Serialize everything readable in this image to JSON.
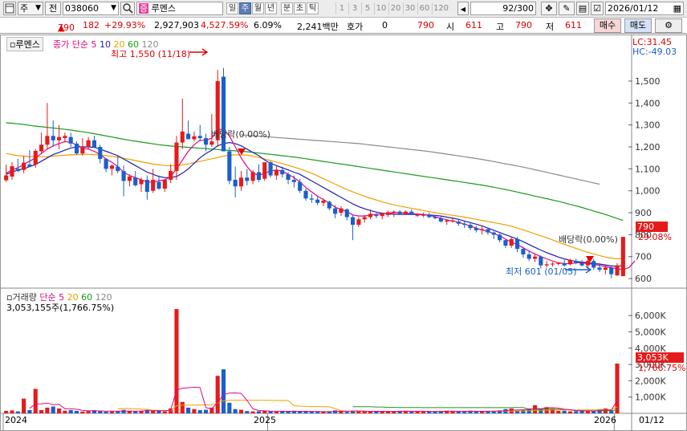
{
  "toolbar": {
    "market": "주",
    "period_prev": "전",
    "code": "038060",
    "name": "루멘스",
    "name_tag": "증",
    "intervals": [
      "일",
      "주",
      "월",
      "년",
      "분",
      "초",
      "틱"
    ],
    "numbers": [
      "1",
      "3",
      "5",
      "10",
      "20",
      "30",
      "60",
      "120"
    ],
    "count": "92",
    "count_total": "/300",
    "date": "2026/01/12"
  },
  "price": {
    "current": "790",
    "arrow": "▲",
    "change": "182",
    "pct": "+29.93%",
    "volume": "2,927,903",
    "vol_pct": "4,527.59%",
    "turnover": "6.09%",
    "amount": "2,241백만",
    "bid_label": "호가",
    "bid_value": "0",
    "ask_value": "790",
    "open_label": "시",
    "open": "611",
    "high_label": "고",
    "high": "790",
    "low_label": "저",
    "low": "611",
    "buy": "매수",
    "sell": "매도"
  },
  "panel1": {
    "name": "루멘스",
    "ma_label": "종가 단순",
    "ma": [
      "5",
      "10",
      "20",
      "60",
      "120"
    ],
    "lc": "LC:31.45",
    "hc": "HC:-49.03",
    "high_mark": "최고 1,550 (11/18)",
    "low_mark": "최저 601 (01/05)",
    "div1": "배당락(0.00%)",
    "div2": "배당락(0.00%)",
    "price_tag": "790",
    "pct_tag": "29.08%"
  },
  "panel2": {
    "name": "거래량",
    "ma_label": "단순",
    "ma": [
      "5",
      "20",
      "60",
      "120"
    ],
    "current": "3,053,155주(1,766.75%)",
    "vol_tag": "3,053K",
    "pct_tag": "1,766.75%"
  },
  "x_axis": [
    "2024",
    "2025",
    "2026",
    "01/12"
  ],
  "colors": {
    "up": "#e51b1b",
    "down": "#1a5fcc",
    "ma5": "#e3067f",
    "ma10": "#1f1fb0",
    "ma20": "#f0a000",
    "ma60": "#1a9a1a",
    "ma120": "#8a8a8a"
  },
  "chart_data": [
    {
      "type": "candlestick",
      "y_axis": [
        "1,500",
        "1,400",
        "1,300",
        "1,200",
        "1,100",
        "1,000",
        "900",
        "800",
        "700",
        "600"
      ],
      "ylim": [
        560,
        1650
      ],
      "candles": [
        [
          1048,
          1120,
          1040,
          1070
        ],
        [
          1065,
          1130,
          1050,
          1112
        ],
        [
          1100,
          1145,
          1085,
          1090
        ],
        [
          1095,
          1160,
          1080,
          1128
        ],
        [
          1120,
          1185,
          1110,
          1110
        ],
        [
          1120,
          1190,
          1105,
          1182
        ],
        [
          1180,
          1265,
          1170,
          1210
        ],
        [
          1210,
          1400,
          1190,
          1250
        ],
        [
          1250,
          1320,
          1200,
          1230
        ],
        [
          1230,
          1300,
          1190,
          1245
        ],
        [
          1240,
          1265,
          1220,
          1250
        ],
        [
          1245,
          1265,
          1200,
          1215
        ],
        [
          1215,
          1225,
          1165,
          1170
        ],
        [
          1170,
          1240,
          1160,
          1200
        ],
        [
          1200,
          1245,
          1190,
          1230
        ],
        [
          1230,
          1250,
          1195,
          1198
        ],
        [
          1200,
          1210,
          1125,
          1145
        ],
        [
          1145,
          1150,
          1085,
          1100
        ],
        [
          1100,
          1120,
          1070,
          1115
        ],
        [
          1110,
          1160,
          1080,
          1090
        ],
        [
          1090,
          1115,
          975,
          1045
        ],
        [
          1045,
          1075,
          1020,
          1065
        ],
        [
          1060,
          1090,
          1020,
          1025
        ],
        [
          1030,
          1060,
          995,
          1050
        ],
        [
          1050,
          1070,
          960,
          995
        ],
        [
          1000,
          1100,
          990,
          1050
        ],
        [
          1040,
          1070,
          1005,
          1010
        ],
        [
          1010,
          1040,
          995,
          1050
        ],
        [
          1050,
          1120,
          1035,
          1090
        ],
        [
          1090,
          1250,
          1050,
          1220
        ],
        [
          1220,
          1420,
          1190,
          1270
        ],
        [
          1260,
          1320,
          1240,
          1235
        ],
        [
          1235,
          1270,
          1225,
          1248
        ],
        [
          1250,
          1300,
          1225,
          1240
        ],
        [
          1240,
          1260,
          1180,
          1210
        ],
        [
          1210,
          1350,
          1200,
          1225
        ],
        [
          1230,
          1550,
          1200,
          1500
        ],
        [
          1520,
          1560,
          1200,
          1180
        ],
        [
          1180,
          1200,
          1030,
          1045
        ],
        [
          1050,
          1110,
          970,
          1020
        ],
        [
          1020,
          1090,
          1000,
          1060
        ],
        [
          1060,
          1100,
          1025,
          1045
        ],
        [
          1045,
          1095,
          1030,
          1085
        ],
        [
          1085,
          1120,
          1040,
          1050
        ],
        [
          1055,
          1115,
          1045,
          1130
        ],
        [
          1130,
          1135,
          1060,
          1070
        ],
        [
          1070,
          1115,
          1050,
          1095
        ],
        [
          1095,
          1110,
          1060,
          1075
        ],
        [
          1075,
          1085,
          1030,
          1050
        ],
        [
          1050,
          1070,
          1015,
          1040
        ],
        [
          1040,
          1055,
          990,
          1000
        ],
        [
          1000,
          1010,
          955,
          965
        ],
        [
          965,
          985,
          945,
          960
        ],
        [
          960,
          975,
          935,
          945
        ],
        [
          945,
          965,
          930,
          955
        ],
        [
          950,
          955,
          910,
          920
        ],
        [
          920,
          935,
          875,
          895
        ],
        [
          900,
          930,
          885,
          920
        ],
        [
          915,
          920,
          865,
          880
        ],
        [
          880,
          890,
          775,
          845
        ],
        [
          845,
          880,
          835,
          870
        ],
        [
          870,
          890,
          855,
          880
        ],
        [
          880,
          915,
          870,
          895
        ],
        [
          890,
          900,
          875,
          885
        ],
        [
          885,
          900,
          870,
          895
        ],
        [
          890,
          910,
          880,
          902
        ],
        [
          900,
          910,
          880,
          905
        ],
        [
          905,
          912,
          895,
          895
        ],
        [
          895,
          910,
          890,
          905
        ],
        [
          905,
          915,
          900,
          890
        ],
        [
          890,
          898,
          880,
          890
        ],
        [
          890,
          900,
          880,
          890
        ],
        [
          890,
          900,
          875,
          880
        ],
        [
          880,
          890,
          870,
          875
        ],
        [
          875,
          885,
          855,
          860
        ],
        [
          860,
          870,
          845,
          865
        ],
        [
          860,
          880,
          855,
          865
        ],
        [
          860,
          870,
          840,
          850
        ],
        [
          850,
          860,
          830,
          845
        ],
        [
          845,
          855,
          820,
          830
        ],
        [
          830,
          840,
          810,
          820
        ],
        [
          820,
          840,
          800,
          825
        ],
        [
          825,
          830,
          800,
          810
        ],
        [
          810,
          815,
          780,
          800
        ],
        [
          800,
          805,
          765,
          775
        ],
        [
          775,
          780,
          740,
          750
        ],
        [
          750,
          790,
          740,
          780
        ],
        [
          780,
          790,
          720,
          735
        ],
        [
          735,
          745,
          695,
          710
        ],
        [
          710,
          730,
          680,
          690
        ],
        [
          690,
          715,
          675,
          700
        ],
        [
          700,
          705,
          645,
          660
        ],
        [
          660,
          680,
          650,
          665
        ],
        [
          665,
          675,
          655,
          668
        ],
        [
          668,
          675,
          660,
          670
        ],
        [
          670,
          685,
          655,
          660
        ],
        [
          665,
          690,
          660,
          685
        ],
        [
          680,
          690,
          665,
          670
        ],
        [
          670,
          685,
          655,
          660
        ],
        [
          660,
          700,
          645,
          680
        ],
        [
          680,
          690,
          640,
          650
        ],
        [
          650,
          670,
          630,
          640
        ],
        [
          640,
          660,
          620,
          650
        ],
        [
          650,
          660,
          601,
          620
        ],
        [
          615,
          670,
          611,
          660
        ],
        [
          611,
          790,
          611,
          790
        ]
      ],
      "ma5": [
        1080,
        1095,
        1105,
        1120,
        1135,
        1150,
        1170,
        1190,
        1205,
        1215,
        1225,
        1220,
        1210,
        1195,
        1190,
        1180,
        1165,
        1145,
        1130,
        1110,
        1085,
        1070,
        1060,
        1050,
        1040,
        1040,
        1045,
        1050,
        1065,
        1100,
        1140,
        1180,
        1210,
        1230,
        1230,
        1240,
        1280,
        1280,
        1250,
        1200,
        1150,
        1110,
        1080,
        1070,
        1080,
        1090,
        1095,
        1090,
        1075,
        1060,
        1040,
        1015,
        995,
        975,
        960,
        945,
        925,
        915,
        905,
        890,
        885,
        885,
        890,
        892,
        895,
        898,
        900,
        900,
        898,
        896,
        894,
        892,
        888,
        882,
        875,
        868,
        862,
        856,
        848,
        840,
        830,
        822,
        815,
        805,
        795,
        780,
        765,
        755,
        740,
        725,
        712,
        700,
        690,
        680,
        672,
        668,
        668,
        672,
        672,
        668,
        665,
        660,
        655,
        650,
        645,
        640,
        650,
        680
      ],
      "ma10": [
        1075,
        1085,
        1095,
        1100,
        1110,
        1120,
        1135,
        1150,
        1165,
        1175,
        1185,
        1195,
        1200,
        1200,
        1200,
        1198,
        1190,
        1180,
        1170,
        1160,
        1145,
        1130,
        1115,
        1100,
        1085,
        1075,
        1065,
        1060,
        1060,
        1065,
        1080,
        1100,
        1125,
        1150,
        1170,
        1185,
        1205,
        1215,
        1220,
        1215,
        1205,
        1190,
        1175,
        1160,
        1140,
        1125,
        1115,
        1105,
        1095,
        1085,
        1075,
        1060,
        1045,
        1030,
        1015,
        1000,
        985,
        970,
        955,
        940,
        928,
        918,
        910,
        903,
        898,
        895,
        893,
        892,
        892,
        892,
        892,
        891,
        890,
        888,
        885,
        880,
        875,
        870,
        862,
        855,
        848,
        840,
        830,
        820,
        810,
        800,
        790,
        780,
        768,
        755,
        742,
        730,
        718,
        708,
        698,
        690,
        683,
        678,
        675,
        672,
        669,
        666,
        662,
        658,
        656,
        660
      ],
      "ma20": [
        1170,
        1165,
        1160,
        1158,
        1156,
        1155,
        1155,
        1156,
        1158,
        1160,
        1162,
        1164,
        1165,
        1166,
        1166,
        1165,
        1163,
        1160,
        1157,
        1153,
        1148,
        1143,
        1138,
        1132,
        1127,
        1122,
        1118,
        1115,
        1114,
        1115,
        1118,
        1122,
        1128,
        1134,
        1140,
        1146,
        1152,
        1158,
        1162,
        1164,
        1164,
        1162,
        1158,
        1152,
        1145,
        1138,
        1131,
        1124,
        1116,
        1108,
        1100,
        1090,
        1080,
        1068,
        1055,
        1043,
        1030,
        1018,
        1006,
        995,
        985,
        975,
        966,
        958,
        950,
        943,
        936,
        930,
        925,
        920,
        915,
        910,
        905,
        900,
        896,
        892,
        888,
        884,
        880,
        875,
        870,
        865,
        860,
        855,
        850,
        845,
        838,
        830,
        822,
        813,
        804,
        795,
        786,
        776,
        766,
        756,
        746,
        737,
        728,
        720,
        712,
        705,
        698,
        693,
        690,
        692
      ],
      "ma60": [
        1310,
        1308,
        1305,
        1302,
        1298,
        1295,
        1292,
        1289,
        1286,
        1283,
        1280,
        1277,
        1273,
        1269,
        1265,
        1260,
        1255,
        1250,
        1245,
        1240,
        1235,
        1230,
        1226,
        1222,
        1218,
        1214,
        1210,
        1207,
        1204,
        1202,
        1200,
        1198,
        1196,
        1194,
        1192,
        1190,
        1188,
        1186,
        1184,
        1182,
        1180,
        1178,
        1175,
        1172,
        1169,
        1166,
        1163,
        1160,
        1157,
        1154,
        1150,
        1146,
        1142,
        1138,
        1134,
        1130,
        1126,
        1122,
        1118,
        1114,
        1110,
        1106,
        1102,
        1098,
        1094,
        1090,
        1086,
        1082,
        1078,
        1074,
        1070,
        1066,
        1062,
        1058,
        1054,
        1050,
        1046,
        1042,
        1038,
        1034,
        1030,
        1026,
        1021,
        1016,
        1011,
        1006,
        1000,
        994,
        988,
        982,
        976,
        970,
        964,
        958,
        952,
        945,
        938,
        931,
        924,
        916,
        908,
        900,
        892,
        883,
        874,
        865
      ],
      "ma120": [
        null,
        null,
        null,
        null,
        null,
        null,
        null,
        null,
        null,
        null,
        null,
        null,
        null,
        null,
        null,
        null,
        null,
        null,
        null,
        null,
        null,
        null,
        null,
        null,
        null,
        null,
        null,
        null,
        null,
        null,
        null,
        null,
        null,
        null,
        null,
        null,
        null,
        null,
        null,
        null,
        1255,
        1253,
        1251,
        1249,
        1247,
        1245,
        1243,
        1241,
        1239,
        1237,
        1235,
        1233,
        1231,
        1229,
        1227,
        1225,
        1223,
        1221,
        1219,
        1217,
        1215,
        1212,
        1209,
        1206,
        1203,
        1200,
        1197,
        1194,
        1191,
        1188,
        1185,
        1182,
        1179,
        1175,
        1171,
        1167,
        1163,
        1159,
        1155,
        1151,
        1147,
        1143,
        1138,
        1133,
        1128,
        1123,
        1118,
        1113,
        1108,
        1102,
        1096,
        1090,
        1084,
        1078,
        1072,
        1066,
        1060,
        1054,
        1048,
        1042,
        1036,
        1030
      ]
    },
    {
      "type": "bar",
      "y_axis": [
        "6,000K",
        "5,000K",
        "4,000K",
        "3,000K",
        "2,000K",
        "1,000K"
      ],
      "ylim": [
        0,
        6500
      ],
      "volumes": [
        150,
        180,
        120,
        900,
        200,
        1500,
        200,
        350,
        420,
        300,
        160,
        200,
        150,
        110,
        140,
        190,
        140,
        100,
        110,
        120,
        210,
        130,
        120,
        140,
        210,
        180,
        150,
        120,
        300,
        6400,
        700,
        350,
        260,
        200,
        220,
        350,
        2300,
        2700,
        650,
        260,
        220,
        140,
        120,
        130,
        160,
        120,
        100,
        130,
        110,
        160,
        120,
        110,
        100,
        90,
        100,
        120,
        180,
        160,
        90,
        160,
        140,
        120,
        110,
        100,
        140,
        110,
        130,
        150,
        130,
        120,
        110,
        130,
        110,
        100,
        140,
        160,
        120,
        110,
        110,
        160,
        130,
        100,
        150,
        120,
        180,
        260,
        300,
        180,
        200,
        300,
        500,
        260,
        380,
        300,
        150,
        160,
        120,
        130,
        200,
        120,
        150,
        260,
        300,
        160,
        3053
      ]
    }
  ]
}
